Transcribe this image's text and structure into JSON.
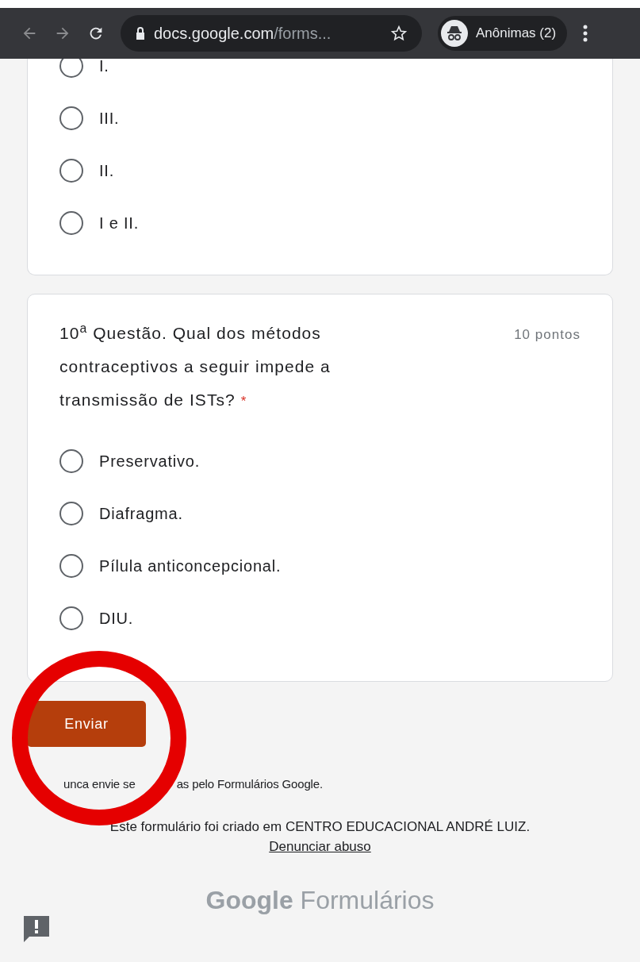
{
  "browser": {
    "url_host": "docs.google.com",
    "url_path": "/forms...",
    "profile_label": "Anônimas (2)"
  },
  "questions": [
    {
      "options": [
        {
          "label": "I.",
          "selected": false
        },
        {
          "label": "III.",
          "selected": false
        },
        {
          "label": "II.",
          "selected": false
        },
        {
          "label": "I e II.",
          "selected": false
        }
      ]
    },
    {
      "title": "10$^{a}$ Questão. Qual dos métodos contraceptivos a seguir impede a transmissão de ISTs?",
      "required_mark": "*",
      "points": "10 pontos",
      "options": [
        {
          "label": "Preservativo.",
          "selected": false
        },
        {
          "label": "Diafragma.",
          "selected": false
        },
        {
          "label": "Pílula anticoncepcional.",
          "selected": false
        },
        {
          "label": "DIU.",
          "selected": false
        }
      ]
    }
  ],
  "submit_button": "Enviar",
  "footer": {
    "warning_part_1": "unca envie se",
    "warning_part_2": "as pelo Formulários Google.",
    "created_by": "Este formulário foi criado em CENTRO EDUCACIONAL ANDRÉ LUIZ.",
    "report_link": "Denunciar abuso",
    "logo_word_1": "Google",
    "logo_word_2": "Formulários"
  },
  "annotation": {
    "kind": "circle",
    "color": "#e50000"
  }
}
